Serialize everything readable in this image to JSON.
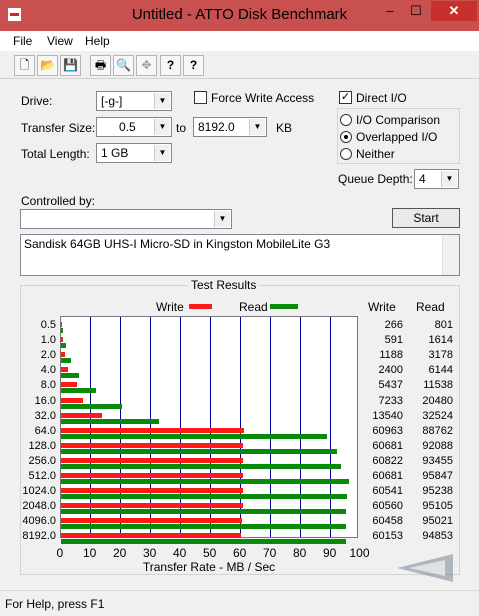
{
  "window": {
    "title": "Untitled - ATTO Disk Benchmark",
    "minimize": "–",
    "maximize": "☐",
    "close": "✕"
  },
  "menu": {
    "file": "File",
    "view": "View",
    "help": "Help"
  },
  "toolbar": {
    "new": "🗋",
    "open": "📂",
    "save": "💾",
    "print": "🖶",
    "preview": "🔍",
    "move": "✥",
    "help": "?",
    "context_help": "?"
  },
  "form": {
    "drive_label": "Drive:",
    "drive_value": "[-g-]",
    "force_write_label": "Force Write Access",
    "force_write_checked": false,
    "direct_io_label": "Direct I/O",
    "direct_io_checked": true,
    "direct_io_mark": "✓",
    "transfer_size_label": "Transfer Size:",
    "transfer_from": "0.5",
    "to_label": "to",
    "transfer_to": "8192.0",
    "kb_label": "KB",
    "total_length_label": "Total Length:",
    "total_length_value": "1 GB",
    "io_comparison_label": "I/O Comparison",
    "overlapped_io_label": "Overlapped I/O",
    "neither_label": "Neither",
    "selected_io": "Overlapped I/O",
    "queue_depth_label": "Queue Depth:",
    "queue_depth_value": "4",
    "controlled_by_label": "Controlled by:",
    "controlled_by_value": "",
    "start_label": "Start",
    "description": "Sandisk 64GB UHS-I Micro-SD in Kingston MobileLite G3"
  },
  "results": {
    "group_title": "Test Results",
    "write_legend": "Write",
    "read_legend": "Read",
    "write_col": "Write",
    "read_col": "Read",
    "write_color": "#ff1a1a",
    "read_color": "#0a8a0a",
    "grid_color": "#0000a0"
  },
  "chart_data": {
    "type": "bar",
    "title": "Test Results",
    "xlabel": "Transfer Rate - MB / Sec",
    "xlim": [
      0,
      100
    ],
    "xticks": [
      "0",
      "10",
      "20",
      "30",
      "40",
      "50",
      "60",
      "70",
      "80",
      "90",
      "100"
    ],
    "categories": [
      "0.5",
      "1.0",
      "2.0",
      "4.0",
      "8.0",
      "16.0",
      "32.0",
      "64.0",
      "128.0",
      "256.0",
      "512.0",
      "1024.0",
      "2048.0",
      "4096.0",
      "8192.0"
    ],
    "series": [
      {
        "name": "Write",
        "color": "#ff1a1a",
        "values": [
          266,
          591,
          1188,
          2400,
          5437,
          7233,
          13540,
          60963,
          60681,
          60822,
          60681,
          60541,
          60560,
          60458,
          60153
        ]
      },
      {
        "name": "Read",
        "color": "#0a8a0a",
        "values": [
          801,
          1614,
          3178,
          6144,
          11538,
          20480,
          32524,
          88762,
          92088,
          93455,
          95847,
          95238,
          95105,
          95021,
          94853
        ]
      }
    ]
  },
  "status": {
    "text": "For Help, press F1"
  }
}
